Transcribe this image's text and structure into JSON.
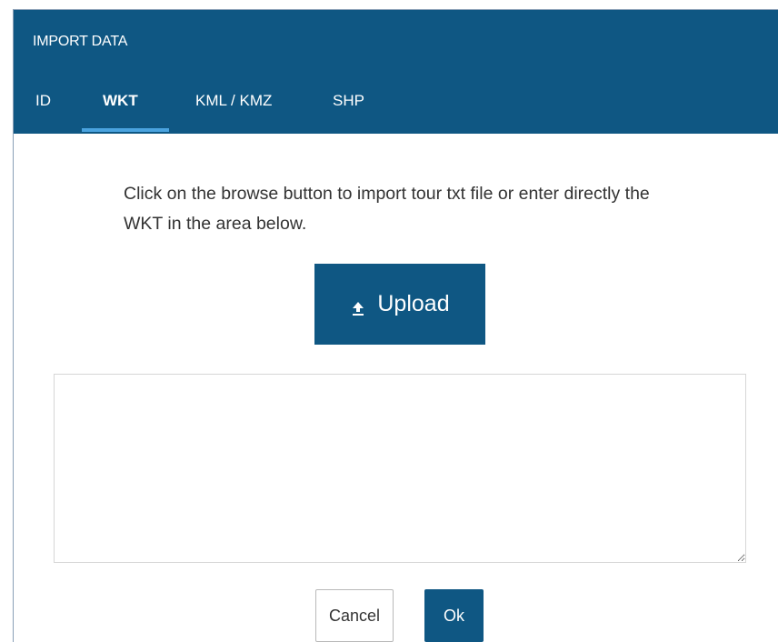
{
  "dialog": {
    "title": "IMPORT DATA"
  },
  "tabs": [
    {
      "label": "ID",
      "active": false
    },
    {
      "label": "WKT",
      "active": true
    },
    {
      "label": "KML / KMZ",
      "active": false
    },
    {
      "label": "SHP",
      "active": false
    }
  ],
  "content": {
    "instructions": "Click on the browse button to import tour txt file or enter directly the WKT in the area below.",
    "upload_label": "Upload",
    "upload_icon": "upload-icon",
    "wkt_value": ""
  },
  "footer": {
    "cancel_label": "Cancel",
    "ok_label": "Ok"
  },
  "colors": {
    "header": "#0f5783",
    "tab_underline": "#4aa3df",
    "primary_button": "#0f5783"
  }
}
